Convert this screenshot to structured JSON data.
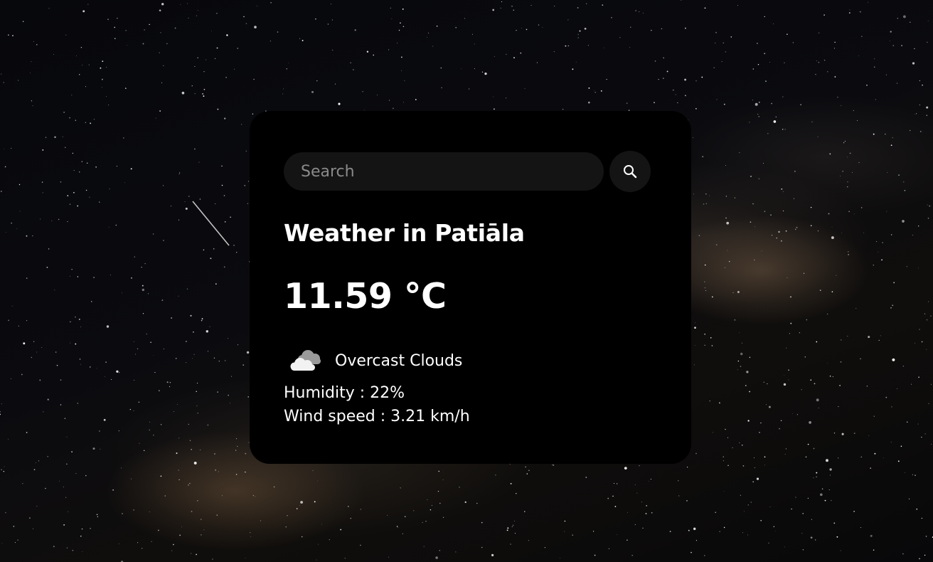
{
  "background": {
    "description": "night-sky",
    "accent_color": "#8a7158"
  },
  "search": {
    "placeholder": "Search",
    "value": "",
    "button_icon": "search-icon"
  },
  "weather": {
    "title": "Weather in Patiāla",
    "temperature": "11.59 °C",
    "condition": "Overcast Clouds",
    "condition_icon": "overcast-clouds-icon",
    "humidity": "Humidity : 22%",
    "wind_speed": "Wind speed : 3.21 km/h"
  },
  "colors": {
    "card_background": "#000000",
    "input_background": "#141414",
    "text": "#ffffff",
    "placeholder": "#8a8a8a"
  }
}
